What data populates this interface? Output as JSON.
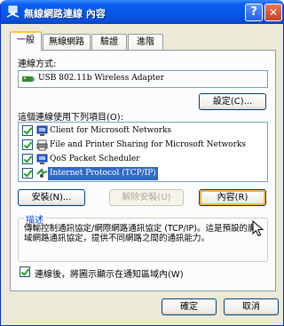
{
  "window": {
    "title": "無線網路連線 內容",
    "help_glyph": "?",
    "close_glyph": "✕"
  },
  "tabs": [
    {
      "label": "一般",
      "active": true
    },
    {
      "label": "無線網路",
      "active": false
    },
    {
      "label": "驗證",
      "active": false
    },
    {
      "label": "進階",
      "active": false
    }
  ],
  "connect_using": {
    "label": "連線方式:",
    "adapter": "USB 802.11b Wireless Adapter",
    "configure_label": "設定(C)..."
  },
  "items": {
    "label": "這個連線使用下列項目(O):",
    "list": [
      {
        "label": "Client for Microsoft Networks",
        "checked": true,
        "icon": "network-client-icon",
        "selected": false
      },
      {
        "label": "File and Printer Sharing for Microsoft Networks",
        "checked": true,
        "icon": "printer-share-icon",
        "selected": false
      },
      {
        "label": "QoS Packet Scheduler",
        "checked": true,
        "icon": "scheduler-icon",
        "selected": false
      },
      {
        "label": "Internet Protocol (TCP/IP)",
        "checked": true,
        "icon": "protocol-icon",
        "selected": true
      }
    ],
    "install_label": "安裝(N)...",
    "uninstall_label": "解除安裝(U)",
    "properties_label": "內容(R)"
  },
  "description": {
    "title": "描述",
    "text": "傳輸控制通訊協定/網際網路通訊協定 (TCP/IP)。這是預設的廣域網路通訊協定，提供不同網路之間的通訊能力。"
  },
  "notify": {
    "label": "連線後，將圖示顯示在通知區域內(W)",
    "checked": true
  },
  "footer": {
    "ok_label": "確定",
    "cancel_label": "取消"
  },
  "colors": {
    "titlebar": "#0a5ef0",
    "selection": "#316ac5",
    "accent_tab": "#ffc73c"
  }
}
